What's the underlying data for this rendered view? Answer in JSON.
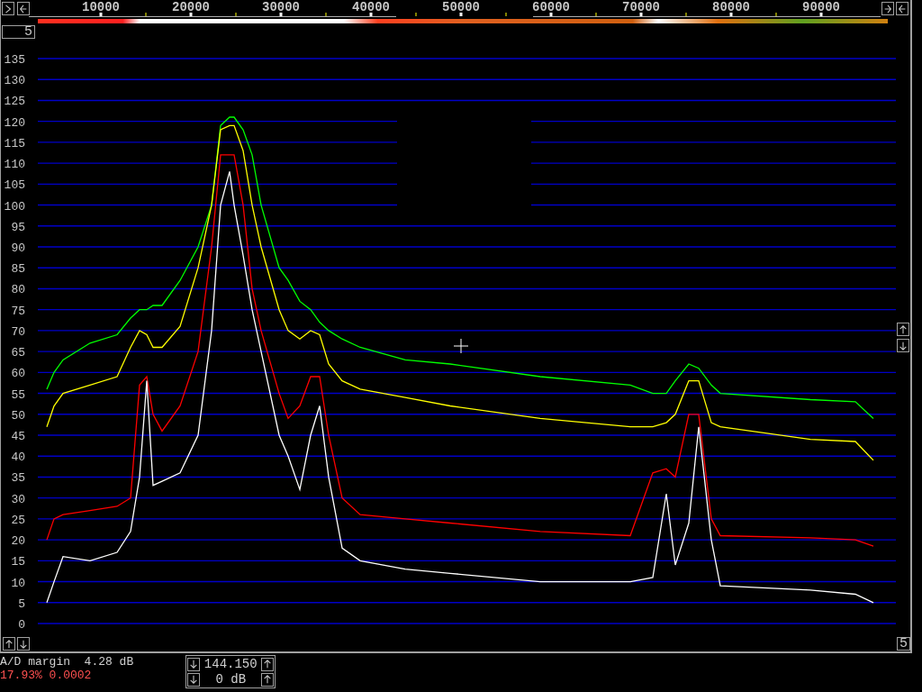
{
  "range_box": "5",
  "spectrum": {
    "chart_data": {
      "type": "line",
      "x": [
        4000,
        4800,
        5800,
        8800,
        11800,
        13300,
        14300,
        15100,
        15800,
        16800,
        18800,
        20800,
        22300,
        23300,
        24300,
        24800,
        25800,
        26800,
        27800,
        29800,
        30800,
        32100,
        33300,
        34300,
        35300,
        36800,
        38800,
        43800,
        48800,
        58800,
        68800,
        71300,
        72800,
        73800,
        75300,
        76400,
        77800,
        78800,
        88800,
        93800,
        95800
      ],
      "series": [
        {
          "color": "#00ff00",
          "values": [
            56,
            60,
            63,
            67,
            69,
            73,
            75,
            75,
            76,
            76,
            82,
            90,
            100,
            119,
            121,
            121,
            118,
            112,
            100,
            85,
            82,
            77,
            75,
            72,
            70,
            68,
            66,
            63,
            62,
            59,
            57,
            55,
            55,
            58,
            62,
            61,
            57,
            55,
            53.5,
            53,
            49
          ]
        },
        {
          "color": "#ffff00",
          "values": [
            47,
            52,
            55,
            57,
            59,
            66,
            70,
            69,
            66,
            66,
            71,
            85,
            100,
            118,
            119,
            119,
            113,
            100,
            90,
            75,
            70,
            68,
            70,
            69,
            62,
            58,
            56,
            54,
            52,
            49,
            47,
            47,
            48,
            50,
            58,
            58,
            48,
            47,
            44,
            43.5,
            39
          ]
        },
        {
          "color": "#ff0000",
          "values": [
            20,
            25,
            26,
            27,
            28,
            30,
            57,
            59,
            50,
            46,
            52,
            65,
            90,
            112,
            112,
            112,
            100,
            80,
            70,
            55,
            49,
            52,
            59,
            59,
            45,
            30,
            26,
            25,
            24,
            22,
            21,
            36,
            37,
            35,
            50,
            50,
            25,
            21,
            20.5,
            20,
            18.5
          ]
        },
        {
          "color": "#ffffff",
          "values": [
            5,
            10,
            16,
            15,
            17,
            22,
            35,
            58,
            33,
            34,
            36,
            45,
            70,
            100,
            108,
            100,
            88,
            75,
            65,
            45,
            40,
            32,
            45,
            52,
            35,
            18,
            15,
            13,
            12,
            10,
            10,
            11,
            31,
            14,
            24,
            47,
            20,
            9,
            8,
            7,
            5
          ]
        }
      ],
      "xticks": [
        10000,
        20000,
        30000,
        40000,
        50000,
        60000,
        70000,
        80000,
        90000
      ],
      "yticks": [
        0,
        5,
        10,
        15,
        20,
        25,
        30,
        35,
        40,
        45,
        50,
        55,
        60,
        65,
        70,
        75,
        80,
        85,
        90,
        95,
        100,
        105,
        110,
        115,
        120,
        125,
        130,
        135
      ],
      "xlim": [
        3000,
        98300
      ],
      "ylim": [
        0,
        135
      ],
      "grid": true
    }
  },
  "zoom_box": "5",
  "status": {
    "ad_margin": "A/D margin  4.28 dB",
    "fft_stats": "17.93% 0.0002"
  },
  "tuning": {
    "frequency": "144.150",
    "gain": "0 dB"
  }
}
